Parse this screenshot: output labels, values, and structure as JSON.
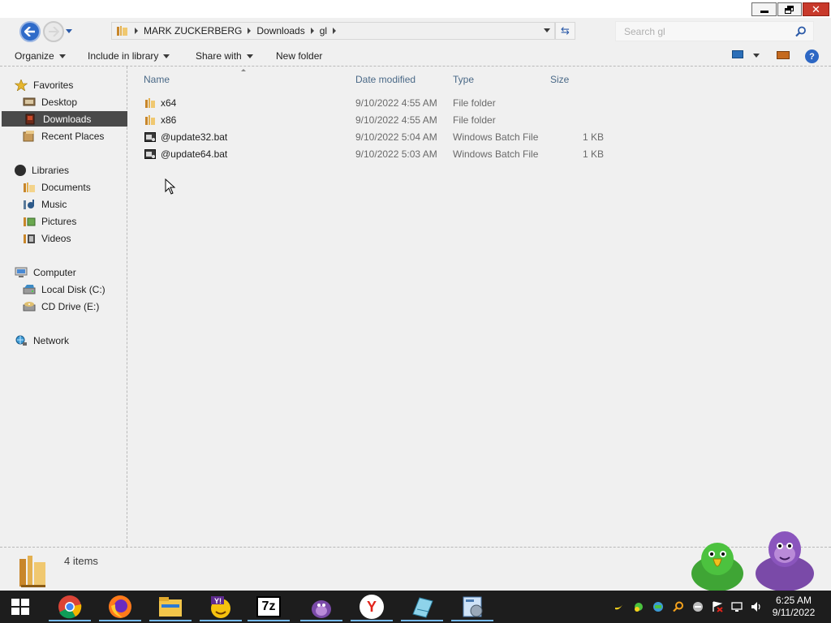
{
  "window": {
    "minimize_icon": "minimize-icon",
    "maximize_icon": "restore-icon",
    "close_glyph": "✕"
  },
  "navigation": {
    "breadcrumbs": [
      "MARK ZUCKERBERG",
      "Downloads",
      "gl"
    ],
    "refresh_glyph": "⇆",
    "search_placeholder": "Search gl"
  },
  "toolbar": {
    "organize": "Organize",
    "include_in_library": "Include in library",
    "share_with": "Share with",
    "new_folder": "New folder",
    "help_glyph": "?"
  },
  "sidebar": {
    "favorites": {
      "label": "Favorites",
      "items": [
        {
          "label": "Desktop",
          "icon": "desktop-icon"
        },
        {
          "label": "Downloads",
          "icon": "downloads-icon",
          "selected": true
        },
        {
          "label": "Recent Places",
          "icon": "recent-places-icon"
        }
      ]
    },
    "libraries": {
      "label": "Libraries",
      "items": [
        {
          "label": "Documents",
          "icon": "documents-icon"
        },
        {
          "label": "Music",
          "icon": "music-icon"
        },
        {
          "label": "Pictures",
          "icon": "pictures-icon"
        },
        {
          "label": "Videos",
          "icon": "videos-icon"
        }
      ]
    },
    "computer": {
      "label": "Computer",
      "items": [
        {
          "label": "Local Disk (C:)",
          "icon": "local-disk-icon"
        },
        {
          "label": "CD Drive (E:)",
          "icon": "cd-drive-icon"
        }
      ]
    },
    "network": {
      "label": "Network"
    }
  },
  "file_list": {
    "columns": {
      "name": "Name",
      "date_modified": "Date modified",
      "type": "Type",
      "size": "Size"
    },
    "rows": [
      {
        "name": "x64",
        "date": "9/10/2022 4:55 AM",
        "type": "File folder",
        "size": "",
        "icon": "folder-icon"
      },
      {
        "name": "x86",
        "date": "9/10/2022 4:55 AM",
        "type": "File folder",
        "size": "",
        "icon": "folder-icon"
      },
      {
        "name": "@update32.bat",
        "date": "9/10/2022 5:04 AM",
        "type": "Windows Batch File",
        "size": "1 KB",
        "icon": "batch-file-icon"
      },
      {
        "name": "@update64.bat",
        "date": "9/10/2022 5:03 AM",
        "type": "Windows Batch File",
        "size": "1 KB",
        "icon": "batch-file-icon"
      }
    ]
  },
  "details_bar": {
    "item_count": "4 items"
  },
  "taskbar": {
    "apps": [
      "chrome",
      "firefox",
      "file-explorer",
      "yahoo-messenger",
      "7-zip",
      "bonzibuddy",
      "yandex-browser",
      "notepad",
      "control-panel"
    ],
    "clock_time": "6:25 AM",
    "clock_date": "9/11/2022",
    "seven_zip_label": "7z",
    "yandex_label": "Y"
  },
  "colors": {
    "selection_bg": "#4a4a4a",
    "column_header": "#4a6987",
    "taskbar_bg": "#1d1d1d"
  }
}
